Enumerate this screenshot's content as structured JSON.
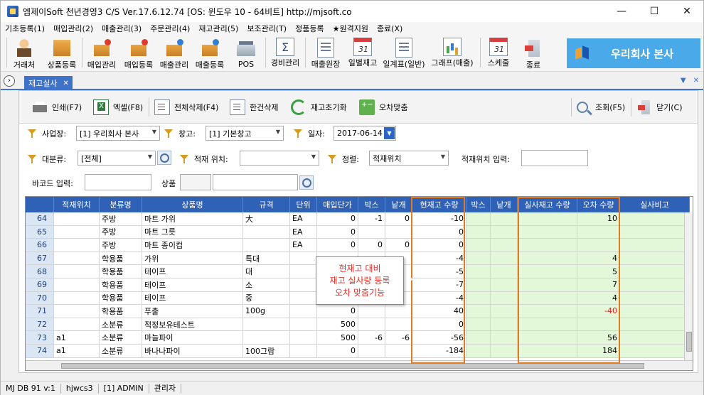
{
  "window": {
    "title": "엠제이Soft 천년경영3 C/S    Ver.17.6.12.74    [OS: 윈도우 10 - 64비트]    http://mjsoft.co",
    "controls": [
      "—",
      "☐",
      "✕"
    ]
  },
  "menu": [
    "기초등록(1)",
    "매입관리(2)",
    "매출관리(3)",
    "주문관리(4)",
    "재고관리(5)",
    "보조관리(T)",
    "정품등록",
    "★원격지원",
    "종료(X)"
  ],
  "toolbar": {
    "buttons": [
      {
        "label": "거래처",
        "icon": "customer-icon"
      },
      {
        "label": "상품등록",
        "icon": "product-box-icon"
      },
      {
        "label": "매입관리",
        "icon": "purchase-manage-icon"
      },
      {
        "label": "매입등록",
        "icon": "purchase-register-icon"
      },
      {
        "label": "매출관리",
        "icon": "sales-manage-icon"
      },
      {
        "label": "매출등록",
        "icon": "sales-register-icon"
      },
      {
        "label": "POS",
        "icon": "pos-terminal-icon"
      },
      {
        "label": "경비관리",
        "icon": "expense-sigma-icon"
      },
      {
        "label": "매출원장",
        "icon": "sales-ledger-icon"
      },
      {
        "label": "일별재고",
        "icon": "daily-stock-icon"
      },
      {
        "label": "일계표(일반)",
        "icon": "daily-report-icon"
      },
      {
        "label": "그래프(매출)",
        "icon": "sales-graph-icon"
      },
      {
        "label": "스케줄",
        "icon": "calendar-icon"
      },
      {
        "label": "종료",
        "icon": "exit-door-icon"
      }
    ],
    "brand": "우리회사 본사"
  },
  "tab": {
    "label": "재고실사",
    "close": "✕"
  },
  "subtoolbar": {
    "print": "인쇄(F7)",
    "excel": "엑셀(F8)",
    "delete_all": "전체삭제(F4)",
    "delete_one": "한건삭제",
    "init_stock": "재고초기화",
    "adjust": "오차맞춤",
    "search": "조회(F5)",
    "close": "닫기(C)"
  },
  "filters": {
    "business_label": "사업장:",
    "business_value": "[1] 우리회사 본사",
    "warehouse_label": "창고:",
    "warehouse_value": "[1] 기본창고",
    "date_label": "일자:",
    "date_value": "2017-06-14",
    "category_label": "대분류:",
    "category_value": "[전체]",
    "location_label": "적재 위치:",
    "location_value": "",
    "sort_label": "정렬:",
    "sort_value": "적재위치",
    "location_input_label": "적재위치 입력:",
    "barcode_label": "바코드 입력:",
    "product_label": "상품"
  },
  "grid": {
    "columns": [
      "",
      "적재위치",
      "분류명",
      "상품명",
      "규격",
      "단위",
      "매입단가",
      "박스",
      "낱개",
      "현재고 수량",
      "박스",
      "낱개",
      "실사재고 수량",
      "오차 수량",
      "실사비고"
    ],
    "rows": [
      [
        "64",
        "",
        "주방",
        "마트 가위",
        "大",
        "EA",
        "0",
        "-1",
        "0",
        "-10",
        "",
        "",
        "",
        "10",
        ""
      ],
      [
        "65",
        "",
        "주방",
        "마트 그릇",
        "",
        "EA",
        "0",
        "",
        "",
        "0",
        "",
        "",
        "",
        "",
        ""
      ],
      [
        "66",
        "",
        "주방",
        "마트 종이컵",
        "",
        "EA",
        "0",
        "0",
        "0",
        "0",
        "",
        "",
        "",
        "",
        ""
      ],
      [
        "67",
        "",
        "학용품",
        "가위",
        "특대",
        "",
        "",
        "",
        "",
        "-4",
        "",
        "",
        "",
        "4",
        ""
      ],
      [
        "68",
        "",
        "학용품",
        "테이프",
        "대",
        "",
        "",
        "",
        "",
        "-5",
        "",
        "",
        "",
        "5",
        ""
      ],
      [
        "69",
        "",
        "학용품",
        "테이프",
        "소",
        "",
        "",
        "",
        "",
        "-7",
        "",
        "",
        "",
        "7",
        ""
      ],
      [
        "70",
        "",
        "학용품",
        "테이프",
        "중",
        "",
        "",
        "",
        "",
        "-4",
        "",
        "",
        "",
        "4",
        ""
      ],
      [
        "71",
        "",
        "학용품",
        "푸출",
        "100g",
        "",
        "0",
        "",
        "",
        "40",
        "",
        "",
        "",
        "-40",
        ""
      ],
      [
        "72",
        "",
        "소분류",
        "적정보유테스트",
        "",
        "",
        "500",
        "",
        "",
        "0",
        "",
        "",
        "",
        "",
        ""
      ],
      [
        "73",
        "a1",
        "소분류",
        "마늘파이",
        "",
        "",
        "500",
        "-6",
        "-6",
        "-56",
        "",
        "",
        "",
        "56",
        ""
      ],
      [
        "74",
        "a1",
        "소분류",
        "바나나파이",
        "100그람",
        "",
        "0",
        "",
        "",
        "-184",
        "",
        "",
        "",
        "184",
        ""
      ]
    ]
  },
  "callout": {
    "line1": "현재고 대비",
    "line2": "재고 실사량 등록",
    "line3": "오차 맞춤기능"
  },
  "status": [
    "MJ DB 91 v:1",
    "hjwcs3",
    "[1] ADMIN",
    "관리자"
  ],
  "colors": {
    "header": "#2f62b7",
    "accent": "#e07b22",
    "green_col": "#e3f7d9",
    "brand": "#4aa9e8",
    "negative": "#e02020"
  }
}
